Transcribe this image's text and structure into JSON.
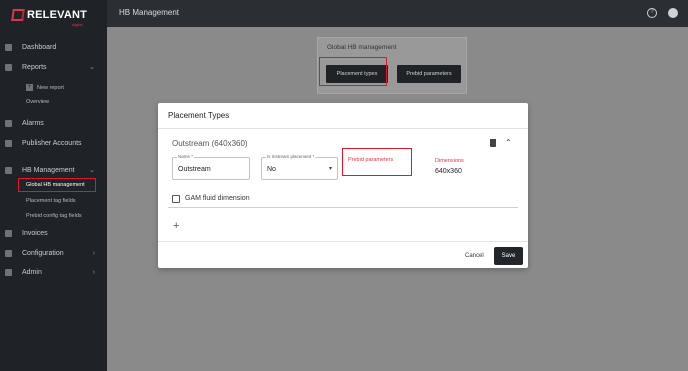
{
  "brand": {
    "name": "RELEVANT",
    "sub": "digital"
  },
  "topbar": {
    "title": "HB Management"
  },
  "sidebar": {
    "items": [
      {
        "label": "Dashboard"
      },
      {
        "label": "Reports"
      },
      {
        "label": "Alarms"
      },
      {
        "label": "Publisher Accounts"
      },
      {
        "label": "HB Management"
      },
      {
        "label": "Invoices"
      },
      {
        "label": "Configuration"
      },
      {
        "label": "Admin"
      }
    ],
    "reports_sub": [
      {
        "label": "New report"
      },
      {
        "label": "Overview"
      }
    ],
    "hb_sub": [
      {
        "label": "Global HB management"
      },
      {
        "label": "Placement tag fields"
      },
      {
        "label": "Prebid config tag fields"
      }
    ]
  },
  "card": {
    "title": "Global HB management",
    "btn_placement": "Placement types",
    "btn_prebid": "Prebid parameters"
  },
  "modal": {
    "title": "Placement Types",
    "placement_title": "Outstream (640x360)",
    "name_label": "Name *",
    "name_value": "Outstream",
    "instream_label": "Is Instream placement *",
    "instream_value": "No",
    "prebid_label": "Prebid parameters",
    "dims_label": "Dimensions",
    "dims_value": "640x360",
    "checkbox_label": "GAM fluid dimension",
    "cancel_label": "Cancel",
    "save_label": "Save"
  }
}
